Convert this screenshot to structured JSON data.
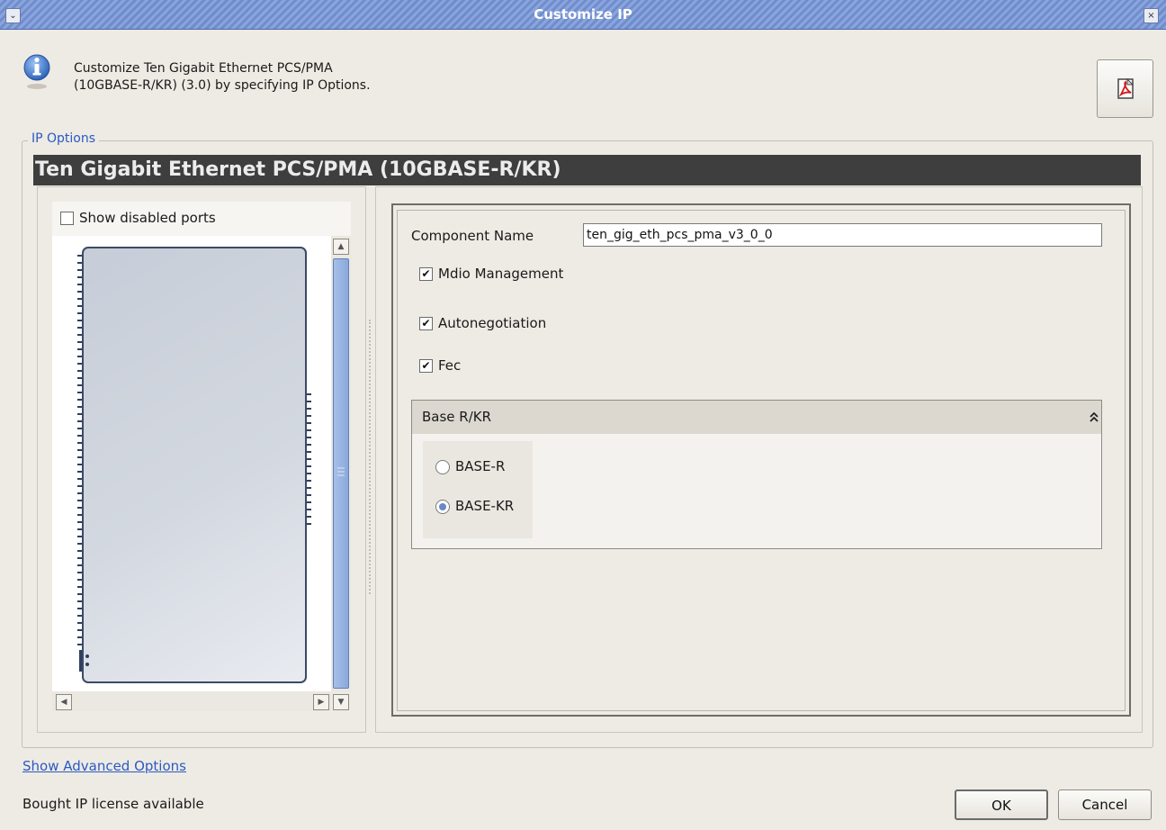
{
  "window": {
    "title": "Customize IP",
    "menu_glyph": "⌄",
    "close_glyph": "×"
  },
  "header": {
    "description": "Customize Ten Gigabit Ethernet PCS/PMA (10GBASE-R/KR) (3.0) by specifying IP Options.",
    "info_icon": "info-icon",
    "pdf_icon": "pdf-icon"
  },
  "ip_options": {
    "legend": "IP Options",
    "banner_title": "Ten Gigabit Ethernet PCS/PMA (10GBASE-R/KR)"
  },
  "left_panel": {
    "show_disabled_ports_label": "Show disabled ports",
    "show_disabled_ports_checked": false
  },
  "form": {
    "component_name_label": "Component Name",
    "component_name_value": "ten_gig_eth_pcs_pma_v3_0_0",
    "mdio_label": "Mdio Management",
    "mdio_checked": true,
    "autoneg_label": "Autonegotiation",
    "autoneg_checked": true,
    "fec_label": "Fec",
    "fec_checked": true,
    "section_title": "Base R/KR",
    "options": [
      {
        "label": "BASE-R",
        "selected": false
      },
      {
        "label": "BASE-KR",
        "selected": true
      }
    ]
  },
  "footer": {
    "advanced_link": "Show Advanced Options",
    "license_text": "Bought IP license available",
    "ok_label": "OK",
    "cancel_label": "Cancel"
  },
  "check_glyph": "✔",
  "colors": {
    "titlebar": "#7f9bd6",
    "banner_bg": "#3e3e3e",
    "link": "#2b59c3",
    "accent_radio": "#6b88c8"
  }
}
